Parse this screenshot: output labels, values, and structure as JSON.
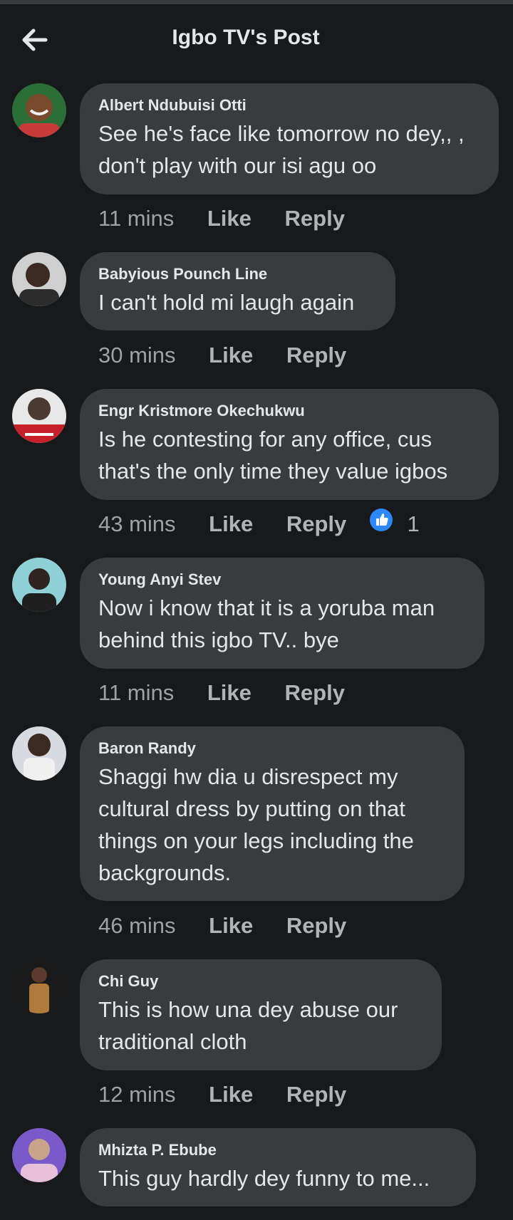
{
  "header": {
    "title": "Igbo TV's Post",
    "back_icon": "arrow-left-icon"
  },
  "comments": [
    {
      "author": "Albert Ndubuisi Otti",
      "text": "See he's face like tomorrow no dey,, , don't play with our isi agu oo",
      "time": "11 mins",
      "like": "Like",
      "reply": "Reply"
    },
    {
      "author": "Babyious Pounch Line",
      "text": "I can't hold mi laugh again",
      "time": "30 mins",
      "like": "Like",
      "reply": "Reply"
    },
    {
      "author": "Engr Kristmore Okechukwu",
      "text": "Is he contesting for any office, cus that's the only time they value igbos",
      "time": "43 mins",
      "like": "Like",
      "reply": "Reply",
      "reactions": {
        "icon": "thumbs-up-icon",
        "count": "1"
      }
    },
    {
      "author": "Young Anyi Stev",
      "text": "Now i know that it is a yoruba man behind this igbo TV.. bye",
      "time": "11 mins",
      "like": "Like",
      "reply": "Reply"
    },
    {
      "author": "Baron Randy",
      "text": "Shaggi hw dia u disrespect my cultural dress by putting on that things on your legs including the backgrounds.",
      "time": "46 mins",
      "like": "Like",
      "reply": "Reply"
    },
    {
      "author": "Chi Guy",
      "text": "This is how una dey abuse our traditional cloth",
      "time": "12 mins",
      "like": "Like",
      "reply": "Reply"
    },
    {
      "author": "Mhizta P. Ebube",
      "text": "This guy hardly dey funny to me...",
      "time": "",
      "like": "",
      "reply": ""
    }
  ],
  "colors": {
    "background": "#18191a",
    "bubble": "#3a3b3c",
    "reaction_blue": "#2d88ff"
  }
}
